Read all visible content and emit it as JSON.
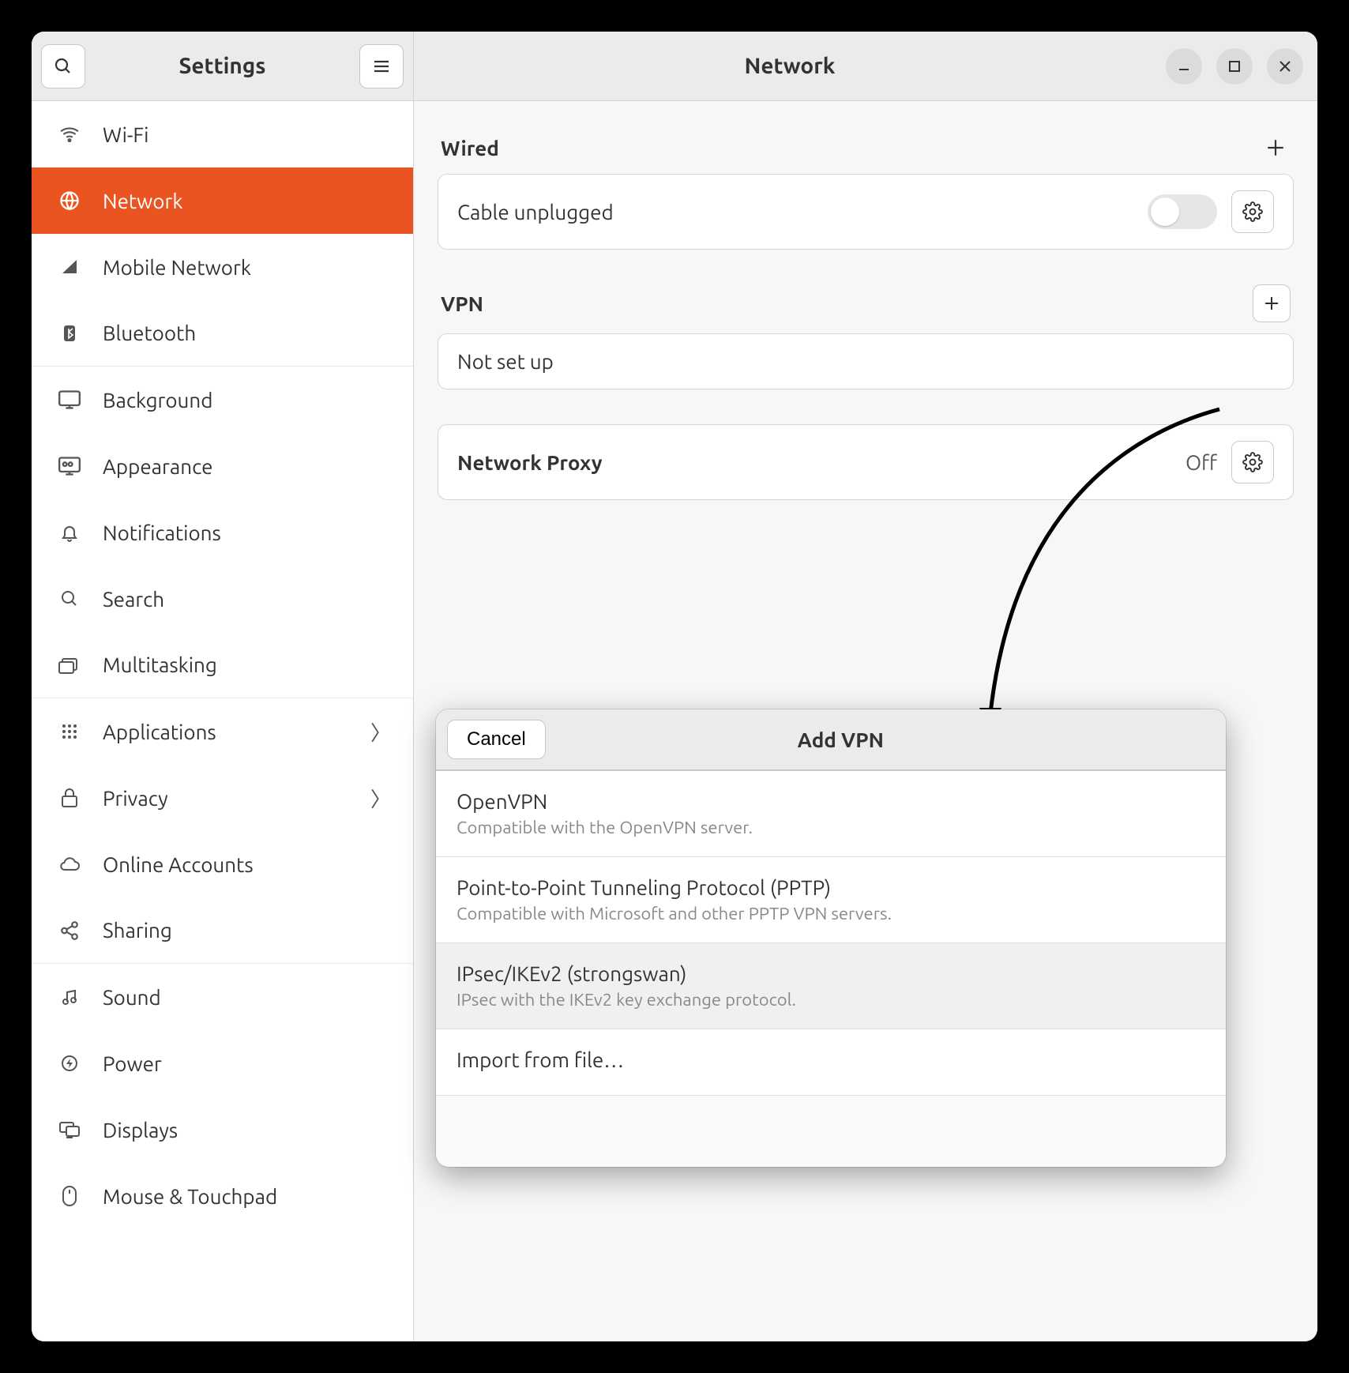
{
  "header": {
    "sidebar_title": "Settings",
    "content_title": "Network"
  },
  "sidebar": {
    "items": [
      {
        "icon": "wifi",
        "label": "Wi-Fi",
        "chevron": false,
        "sep": false
      },
      {
        "icon": "globe",
        "label": "Network",
        "chevron": false,
        "sep": false,
        "selected": true
      },
      {
        "icon": "mobile",
        "label": "Mobile Network",
        "chevron": false,
        "sep": false
      },
      {
        "icon": "bluetooth",
        "label": "Bluetooth",
        "chevron": false,
        "sep": true
      },
      {
        "icon": "background",
        "label": "Background",
        "chevron": false,
        "sep": false
      },
      {
        "icon": "appearance",
        "label": "Appearance",
        "chevron": false,
        "sep": false
      },
      {
        "icon": "bell",
        "label": "Notifications",
        "chevron": false,
        "sep": false
      },
      {
        "icon": "search",
        "label": "Search",
        "chevron": false,
        "sep": false
      },
      {
        "icon": "multitask",
        "label": "Multitasking",
        "chevron": false,
        "sep": true
      },
      {
        "icon": "apps",
        "label": "Applications",
        "chevron": true,
        "sep": false
      },
      {
        "icon": "lock",
        "label": "Privacy",
        "chevron": true,
        "sep": false
      },
      {
        "icon": "cloud",
        "label": "Online Accounts",
        "chevron": false,
        "sep": false
      },
      {
        "icon": "share",
        "label": "Sharing",
        "chevron": false,
        "sep": true
      },
      {
        "icon": "sound",
        "label": "Sound",
        "chevron": false,
        "sep": false
      },
      {
        "icon": "power",
        "label": "Power",
        "chevron": false,
        "sep": false
      },
      {
        "icon": "displays",
        "label": "Displays",
        "chevron": false,
        "sep": false
      },
      {
        "icon": "mouse",
        "label": "Mouse & Touchpad",
        "chevron": false,
        "sep": false
      }
    ]
  },
  "network": {
    "wired": {
      "title": "Wired",
      "status": "Cable unplugged"
    },
    "vpn": {
      "title": "VPN",
      "status": "Not set up"
    },
    "proxy": {
      "title": "Network Proxy",
      "status": "Off"
    }
  },
  "dialog": {
    "cancel": "Cancel",
    "title": "Add VPN",
    "options": [
      {
        "name": "OpenVPN",
        "desc": "Compatible with the OpenVPN server."
      },
      {
        "name": "Point-to-Point Tunneling Protocol (PPTP)",
        "desc": "Compatible with Microsoft and other PPTP VPN servers."
      },
      {
        "name": "IPsec/IKEv2 (strongswan)",
        "desc": "IPsec with the IKEv2 key exchange protocol.",
        "selected": true
      },
      {
        "name": "Import from file…",
        "desc": ""
      }
    ]
  }
}
